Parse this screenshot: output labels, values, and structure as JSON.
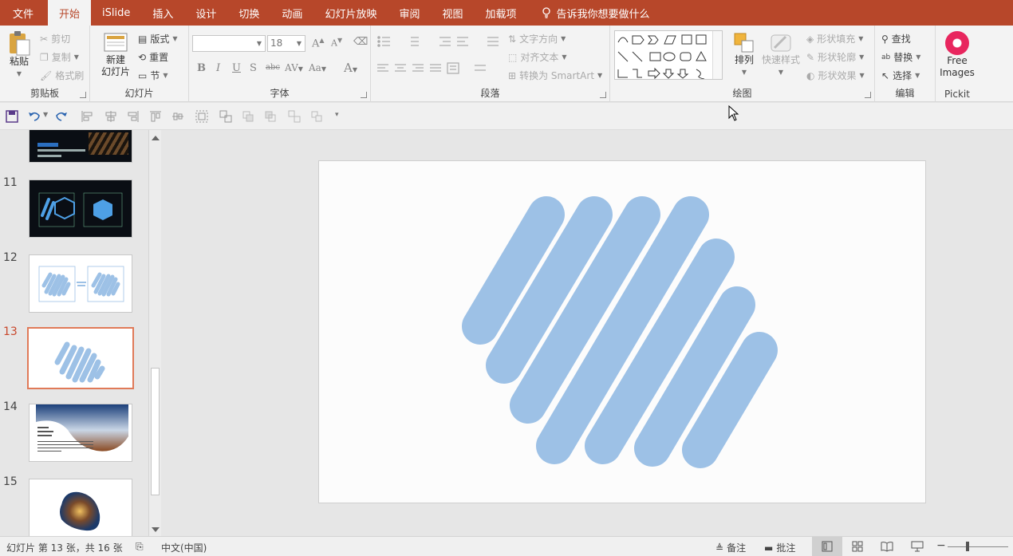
{
  "tabs": [
    "文件",
    "开始",
    "iSlide",
    "插入",
    "设计",
    "切换",
    "动画",
    "幻灯片放映",
    "审阅",
    "视图",
    "加载项"
  ],
  "active_tab": "开始",
  "tell_me": "告诉我你想要做什么",
  "clipboard": {
    "paste": "粘贴",
    "cut": "剪切",
    "copy": "复制",
    "format_painter": "格式刷",
    "label": "剪贴板"
  },
  "slides_group": {
    "new_slide_1": "新建",
    "new_slide_2": "幻灯片",
    "layout": "版式",
    "reset": "重置",
    "section": "节",
    "label": "幻灯片"
  },
  "font": {
    "name_value": "",
    "size_value": "18",
    "bold": "B",
    "italic": "I",
    "underline": "U",
    "shadow": "S",
    "strike": "abc",
    "spacing": "AV",
    "case": "Aa",
    "color": "A",
    "grow": "A",
    "shrink": "A",
    "label": "字体"
  },
  "paragraph": {
    "text_direction": "文字方向",
    "align_text": "对齐文本",
    "smartart": "转换为 SmartArt",
    "label": "段落"
  },
  "drawing": {
    "arrange": "排列",
    "quick_styles": "快速样式",
    "fill": "形状填充",
    "outline": "形状轮廓",
    "effects": "形状效果",
    "label": "绘图"
  },
  "editing": {
    "find": "查找",
    "replace": "替换",
    "select": "选择",
    "label": "编辑"
  },
  "pickit": {
    "line1": "Free",
    "line2": "Images",
    "label": "Pickit"
  },
  "thumbnails": [
    {
      "num": "11",
      "dark": true
    },
    {
      "num": "12",
      "dark": false
    },
    {
      "num": "13",
      "dark": false,
      "selected": true
    },
    {
      "num": "14",
      "dark": false
    },
    {
      "num": "15",
      "dark": false
    }
  ],
  "status": {
    "slide_info": "幻灯片 第 13 张，共 16 张",
    "language": "中文(中国)",
    "notes": "备注",
    "comments": "批注"
  },
  "colors": {
    "accent": "#b7472a",
    "stripe": "#9dc1e6",
    "selected_border": "#e07a58"
  }
}
